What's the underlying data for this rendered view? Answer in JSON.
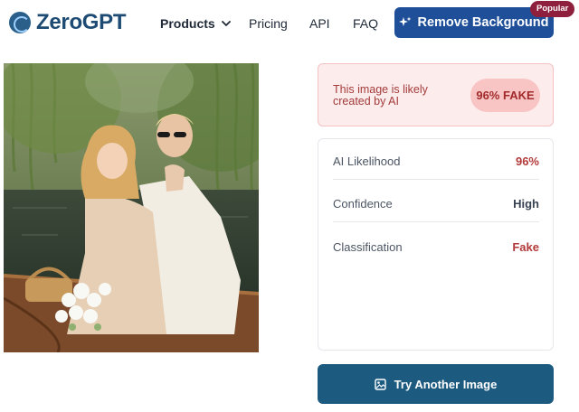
{
  "header": {
    "logo_text": "ZeroGPT",
    "nav": {
      "products": "Products",
      "pricing": "Pricing",
      "api": "API",
      "faq": "FAQ"
    },
    "remove_bg_label": "Remove Background",
    "popular_badge": "Popular"
  },
  "result": {
    "message": "This image is likely created by AI",
    "verdict": "96% FAKE"
  },
  "stats": [
    {
      "label": "AI Likelihood",
      "value": "96%"
    },
    {
      "label": "Confidence",
      "value": "High"
    },
    {
      "label": "Classification",
      "value": "Fake"
    }
  ],
  "actions": {
    "try_another_label": "Try Another Image"
  },
  "colors": {
    "brand": "#1d4b73",
    "primary_button": "#1e4f98",
    "try_button": "#1c5a80",
    "fake_red": "#b23a3a",
    "popular_badge": "#8e1f3d"
  },
  "icons": {
    "logo": "brain-logo-icon",
    "products_chevron": "chevron-down-icon",
    "remove_bg": "sparkle-icon",
    "try_another": "image-icon"
  }
}
